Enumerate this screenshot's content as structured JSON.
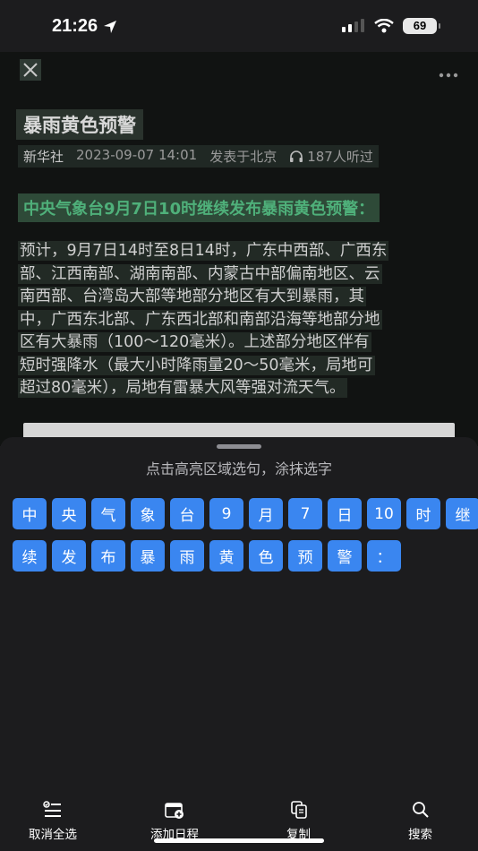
{
  "status_bar": {
    "time": "21:26",
    "battery": "69"
  },
  "article": {
    "title": "暴雨黄色预警",
    "source": "新华社",
    "datetime": "2023-09-07 14:01",
    "location": "发表于北京",
    "listeners": "187人听过",
    "subhead": "中央气象台9月7日10时继续发布暴雨黄色预警：",
    "body_lines": [
      "预计，9月7日14时至8日14时，广东中西部、广西东",
      "部、江西南部、湖南南部、内蒙古中部偏南地区、云",
      "南西部、台湾岛大部等地部分地区有大到暴雨，其",
      "中，广西东北部、广东西北部和南部沿海等地部分地",
      "区有大暴雨（100～120毫米）。上述部分地区伴有",
      "短时强降水（最大小时降雨量20～50毫米，局地可",
      "超过80毫米），局地有雷暴大风等强对流天气。"
    ]
  },
  "sheet": {
    "hint": "点击高亮区域选句，涂抹选字",
    "chips_row1": [
      "中",
      "央",
      "气",
      "象",
      "台",
      "9",
      "月",
      "7",
      "日",
      "10",
      "时",
      "继"
    ],
    "chips_row2": [
      "续",
      "发",
      "布",
      "暴",
      "雨",
      "黄",
      "色",
      "预",
      "警",
      "："
    ]
  },
  "toolbar": {
    "deselect": "取消全选",
    "add_schedule": "添加日程",
    "copy": "复制",
    "search": "搜索"
  },
  "icons": {
    "close": "close-icon",
    "more": "more-icon",
    "headphone": "headphone-icon",
    "deselect": "list-check-icon",
    "schedule": "calendar-add-icon",
    "copy": "copy-icon",
    "search": "search-icon"
  }
}
